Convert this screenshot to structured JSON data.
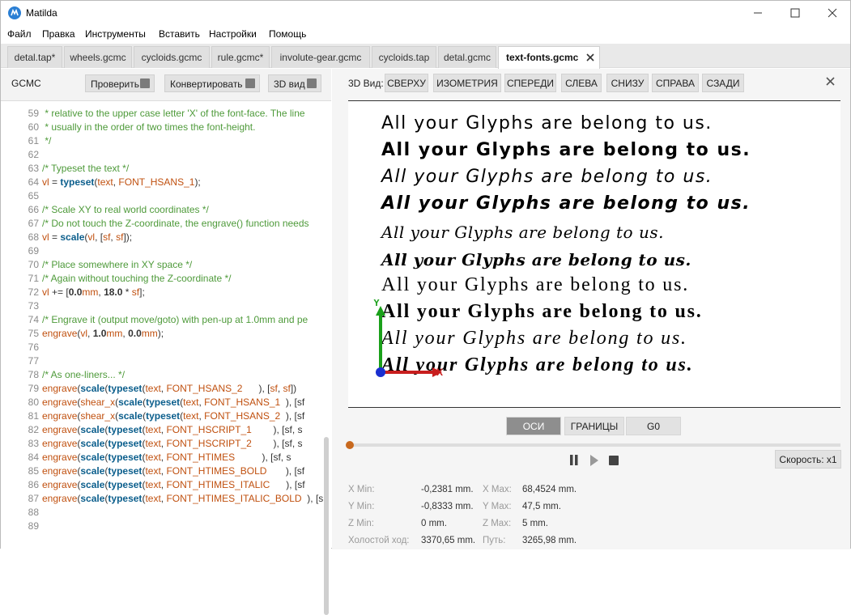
{
  "app": {
    "title": "Matilda"
  },
  "menu": [
    "Файл",
    "Правка",
    "Инструменты",
    "Вставить",
    "Настройки",
    "Помощь"
  ],
  "tabs": [
    {
      "label": "detal.tap*"
    },
    {
      "label": "wheels.gcmc"
    },
    {
      "label": "cycloids.gcmc"
    },
    {
      "label": "rule.gcmc*"
    },
    {
      "label": "involute-gear.gcmc"
    },
    {
      "label": "cycloids.tap"
    },
    {
      "label": "detal.gcmc"
    },
    {
      "label": "text-fonts.gcmc",
      "active": true
    }
  ],
  "editor": {
    "label": "GCMC",
    "buttons": {
      "check": "Проверить",
      "convert": "Конвертировать",
      "view3d": "3D вид"
    },
    "lines": [
      {
        "n": "59",
        "segs": [
          [
            "comment",
            " * relative to the upper case letter 'X' of the font-face. The line"
          ]
        ]
      },
      {
        "n": "60",
        "segs": [
          [
            "comment",
            " * usually in the order of two times the font-height."
          ]
        ]
      },
      {
        "n": "61",
        "segs": [
          [
            "comment",
            " */"
          ]
        ]
      },
      {
        "n": "62",
        "segs": []
      },
      {
        "n": "63",
        "segs": [
          [
            "comment",
            "/* Typeset the text */"
          ]
        ]
      },
      {
        "n": "64",
        "segs": [
          [
            "var",
            "vl"
          ],
          [
            "plain",
            " = "
          ],
          [
            "fn",
            "typeset"
          ],
          [
            "plain",
            "("
          ],
          [
            "txt",
            "text"
          ],
          [
            "plain",
            ", "
          ],
          [
            "const",
            "FONT_HSANS_1"
          ],
          [
            "plain",
            ");"
          ]
        ]
      },
      {
        "n": "65",
        "segs": []
      },
      {
        "n": "66",
        "segs": [
          [
            "comment",
            "/* Scale XY to real world coordinates */"
          ]
        ]
      },
      {
        "n": "67",
        "segs": [
          [
            "comment",
            "/* Do not touch the Z-coordinate, the engrave() function needs"
          ]
        ]
      },
      {
        "n": "68",
        "segs": [
          [
            "var",
            "vl"
          ],
          [
            "plain",
            " = "
          ],
          [
            "fn",
            "scale"
          ],
          [
            "plain",
            "("
          ],
          [
            "var",
            "vl"
          ],
          [
            "plain",
            ", ["
          ],
          [
            "var",
            "sf"
          ],
          [
            "plain",
            ", "
          ],
          [
            "var",
            "sf"
          ],
          [
            "plain",
            "]);"
          ]
        ]
      },
      {
        "n": "69",
        "segs": []
      },
      {
        "n": "70",
        "segs": [
          [
            "comment",
            "/* Place somewhere in XY space */"
          ]
        ]
      },
      {
        "n": "71",
        "segs": [
          [
            "comment",
            "/* Again without touching the Z-coordinate */"
          ]
        ]
      },
      {
        "n": "72",
        "segs": [
          [
            "var",
            "vl"
          ],
          [
            "plain",
            " += ["
          ],
          [
            "num",
            "0.0"
          ],
          [
            "var",
            "mm"
          ],
          [
            "plain",
            ", "
          ],
          [
            "num",
            "18.0"
          ],
          [
            "plain",
            " * "
          ],
          [
            "var",
            "sf"
          ],
          [
            "plain",
            "];"
          ]
        ]
      },
      {
        "n": "73",
        "segs": []
      },
      {
        "n": "74",
        "segs": [
          [
            "comment",
            "/* Engrave it (output move/goto) with pen-up at 1.0mm and pe"
          ]
        ]
      },
      {
        "n": "75",
        "segs": [
          [
            "txt",
            "engrave"
          ],
          [
            "plain",
            "("
          ],
          [
            "var",
            "vl"
          ],
          [
            "plain",
            ", "
          ],
          [
            "num",
            "1.0"
          ],
          [
            "var",
            "mm"
          ],
          [
            "plain",
            ", "
          ],
          [
            "num",
            "0.0"
          ],
          [
            "var",
            "mm"
          ],
          [
            "plain",
            ");"
          ]
        ]
      },
      {
        "n": "76",
        "segs": []
      },
      {
        "n": "77",
        "segs": []
      },
      {
        "n": "78",
        "segs": [
          [
            "comment",
            "/* As one-liners... */"
          ]
        ]
      },
      {
        "n": "79",
        "segs": [
          [
            "txt",
            "engrave"
          ],
          [
            "plain",
            "("
          ],
          [
            "fn",
            "scale"
          ],
          [
            "plain",
            "("
          ],
          [
            "fn",
            "typeset"
          ],
          [
            "plain",
            "("
          ],
          [
            "txt",
            "text"
          ],
          [
            "plain",
            ", "
          ],
          [
            "const",
            "FONT_HSANS_2      "
          ],
          [
            "plain",
            "), ["
          ],
          [
            "var",
            "sf"
          ],
          [
            "plain",
            ", "
          ],
          [
            "var",
            "sf"
          ],
          [
            "plain",
            "])"
          ]
        ]
      },
      {
        "n": "80",
        "segs": [
          [
            "txt",
            "engrave"
          ],
          [
            "plain",
            "("
          ],
          [
            "txt",
            "shear_x"
          ],
          [
            "plain",
            "("
          ],
          [
            "fn",
            "scale"
          ],
          [
            "plain",
            "("
          ],
          [
            "fn",
            "typeset"
          ],
          [
            "plain",
            "("
          ],
          [
            "txt",
            "text"
          ],
          [
            "plain",
            ", "
          ],
          [
            "const",
            "FONT_HSANS_1  "
          ],
          [
            "plain",
            "), [sf"
          ]
        ]
      },
      {
        "n": "81",
        "segs": [
          [
            "txt",
            "engrave"
          ],
          [
            "plain",
            "("
          ],
          [
            "txt",
            "shear_x"
          ],
          [
            "plain",
            "("
          ],
          [
            "fn",
            "scale"
          ],
          [
            "plain",
            "("
          ],
          [
            "fn",
            "typeset"
          ],
          [
            "plain",
            "("
          ],
          [
            "txt",
            "text"
          ],
          [
            "plain",
            ", "
          ],
          [
            "const",
            "FONT_HSANS_2  "
          ],
          [
            "plain",
            "), [sf"
          ]
        ]
      },
      {
        "n": "82",
        "segs": [
          [
            "txt",
            "engrave"
          ],
          [
            "plain",
            "("
          ],
          [
            "fn",
            "scale"
          ],
          [
            "plain",
            "("
          ],
          [
            "fn",
            "typeset"
          ],
          [
            "plain",
            "("
          ],
          [
            "txt",
            "text"
          ],
          [
            "plain",
            ", "
          ],
          [
            "const",
            "FONT_HSCRIPT_1        "
          ],
          [
            "plain",
            "), [sf, s"
          ]
        ]
      },
      {
        "n": "83",
        "segs": [
          [
            "txt",
            "engrave"
          ],
          [
            "plain",
            "("
          ],
          [
            "fn",
            "scale"
          ],
          [
            "plain",
            "("
          ],
          [
            "fn",
            "typeset"
          ],
          [
            "plain",
            "("
          ],
          [
            "txt",
            "text"
          ],
          [
            "plain",
            ", "
          ],
          [
            "const",
            "FONT_HSCRIPT_2        "
          ],
          [
            "plain",
            "), [sf, s"
          ]
        ]
      },
      {
        "n": "84",
        "segs": [
          [
            "txt",
            "engrave"
          ],
          [
            "plain",
            "("
          ],
          [
            "fn",
            "scale"
          ],
          [
            "plain",
            "("
          ],
          [
            "fn",
            "typeset"
          ],
          [
            "plain",
            "("
          ],
          [
            "txt",
            "text"
          ],
          [
            "plain",
            ", "
          ],
          [
            "const",
            "FONT_HTIMES          "
          ],
          [
            "plain",
            "), [sf, s"
          ]
        ]
      },
      {
        "n": "85",
        "segs": [
          [
            "txt",
            "engrave"
          ],
          [
            "plain",
            "("
          ],
          [
            "fn",
            "scale"
          ],
          [
            "plain",
            "("
          ],
          [
            "fn",
            "typeset"
          ],
          [
            "plain",
            "("
          ],
          [
            "txt",
            "text"
          ],
          [
            "plain",
            ", "
          ],
          [
            "const",
            "FONT_HTIMES_BOLD       "
          ],
          [
            "plain",
            "), [sf"
          ]
        ]
      },
      {
        "n": "86",
        "segs": [
          [
            "txt",
            "engrave"
          ],
          [
            "plain",
            "("
          ],
          [
            "fn",
            "scale"
          ],
          [
            "plain",
            "("
          ],
          [
            "fn",
            "typeset"
          ],
          [
            "plain",
            "("
          ],
          [
            "txt",
            "text"
          ],
          [
            "plain",
            ", "
          ],
          [
            "const",
            "FONT_HTIMES_ITALIC      "
          ],
          [
            "plain",
            "), [sf"
          ]
        ]
      },
      {
        "n": "87",
        "segs": [
          [
            "txt",
            "engrave"
          ],
          [
            "plain",
            "("
          ],
          [
            "fn",
            "scale"
          ],
          [
            "plain",
            "("
          ],
          [
            "fn",
            "typeset"
          ],
          [
            "plain",
            "("
          ],
          [
            "txt",
            "text"
          ],
          [
            "plain",
            ", "
          ],
          [
            "const",
            "FONT_HTIMES_ITALIC_BOLD"
          ],
          [
            "plain",
            "  ), [sf"
          ]
        ]
      },
      {
        "n": "88",
        "segs": []
      },
      {
        "n": "89",
        "segs": []
      }
    ]
  },
  "viewer": {
    "label": "3D Вид:",
    "view_buttons": [
      "СВЕРХУ",
      "ИЗОМЕТРИЯ",
      "СПЕРЕДИ",
      "СЛЕВА",
      "СНИЗУ",
      "СПРАВА",
      "СЗАДИ"
    ],
    "glyph_text": "All your Glyphs are belong to us.",
    "axis_x_label": "X",
    "axis_y_label": "Y",
    "mode_tabs": [
      "ОСИ",
      "ГРАНИЦЫ",
      "G0"
    ],
    "active_mode": "ОСИ",
    "speed": "Скорость: x1",
    "progress": 0.0,
    "stats": [
      {
        "label": "X Min:",
        "value": "-0,2381 mm.",
        "label2": "X Max:",
        "value2": "68,4524 mm."
      },
      {
        "label": "Y Min:",
        "value": "-0,8333 mm.",
        "label2": "Y Max:",
        "value2": "47,5 mm."
      },
      {
        "label": "Z Min:",
        "value": "0 mm.",
        "label2": "Z Max:",
        "value2": "5 mm."
      },
      {
        "label": "Холостой ход:",
        "value": "3370,65 mm.",
        "label2": "Путь:",
        "value2": "3265,98 mm."
      }
    ]
  },
  "colors": {
    "accent": "#2b7fd4",
    "axis_x": "#c81e1e",
    "axis_y": "#1aa01a",
    "axis_z": "#1a2fd0",
    "handle": "#c8691e"
  }
}
